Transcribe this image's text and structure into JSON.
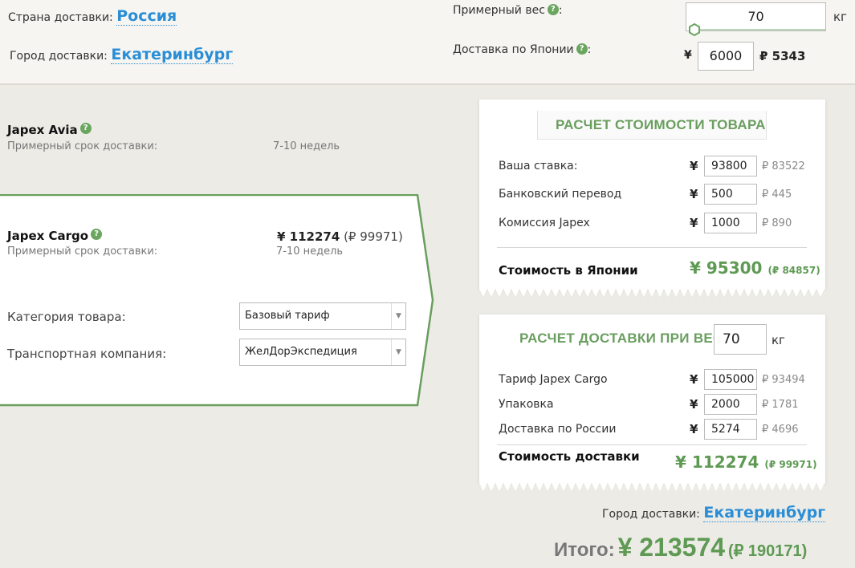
{
  "header": {
    "country_label": "Страна доставки:",
    "country_value": "Россия",
    "city_label": "Город доставки:",
    "city_value": "Екатеринбург",
    "weight_label": "Примерный вес",
    "weight_value": "70",
    "weight_unit": "кг",
    "japan_delivery_label": "Доставка по Японии",
    "colon": ":",
    "japan_delivery_currency": "¥",
    "japan_delivery_value": "6000",
    "japan_delivery_rub": "₽ 5343"
  },
  "tariffs": {
    "avia": {
      "name": "Japex Avia",
      "term_label": "Примерный срок доставки:",
      "term_value": "7-10 недель"
    },
    "cargo": {
      "name": "Japex Cargo",
      "term_label": "Примерный срок доставки:",
      "term_value": "7-10 недель",
      "price_yen": "¥ 112274",
      "price_rub": "(₽ 99971)",
      "category_label": "Категория товара:",
      "category_value": "Базовый тариф",
      "transport_label": "Транспортная компания:",
      "transport_value": "ЖелДорЭкспедиция"
    }
  },
  "goods_card": {
    "title": "РАСЧЕТ СТОИМОСТИ ТОВАРА",
    "rows": [
      {
        "label": "Ваша ставка:",
        "currency": "¥",
        "value": "93800",
        "rub": "₽ 83522"
      },
      {
        "label": "Банковский перевод",
        "currency": "¥",
        "value": "500",
        "rub": "₽ 445"
      },
      {
        "label": "Комиссия Japex",
        "currency": "¥",
        "value": "1000",
        "rub": "₽ 890"
      }
    ],
    "total_label": "Стоимость в Японии",
    "total_yen": "¥ 95300",
    "total_rub": "(₽ 84857)"
  },
  "delivery_card": {
    "title": "РАСЧЕТ ДОСТАВКИ ПРИ ВЕСЕ",
    "weight_value": "70",
    "weight_unit": "кг",
    "rows": [
      {
        "label": "Тариф Japex Cargo",
        "currency": "¥",
        "value": "105000",
        "rub": "₽ 93494"
      },
      {
        "label": "Упаковка",
        "currency": "¥",
        "value": "2000",
        "rub": "₽ 1781"
      },
      {
        "label": "Доставка по России",
        "currency": "¥",
        "value": "5274",
        "rub": "₽ 4696"
      }
    ],
    "total_label": "Стоимость доставки",
    "total_yen": "¥ 112274",
    "total_rub": "(₽ 99971)"
  },
  "footer": {
    "city_label": "Город доставки:",
    "city_value": "Екатеринбург",
    "grand_label": "Итого:",
    "grand_yen": "¥ 213574",
    "grand_rub": "(₽ 190171)"
  },
  "help_glyph": "?",
  "caret_glyph": "▼",
  "colors": {
    "accent_green": "#5e9a53",
    "link_blue": "#2a8ed6",
    "panel_border": "#6a9e5f"
  }
}
